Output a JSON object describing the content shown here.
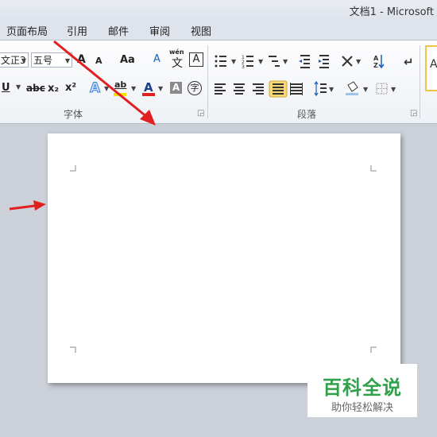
{
  "titlebar": {
    "title": "文档1 - Microsoft"
  },
  "tabs": [
    "页面布局",
    "引用",
    "邮件",
    "审阅",
    "视图"
  ],
  "font_group": {
    "label": "字体",
    "font_name": "文正3",
    "font_size": "五号",
    "grow": "A",
    "shrink": "A",
    "change_case": "Aa",
    "clear_format": "A",
    "pinyin": "wén",
    "pinyin_char": "文",
    "border": "A",
    "underline": "U",
    "strike": "abc",
    "subscript": "x₂",
    "superscript": "x²",
    "text_effect": "A",
    "highlight": "ab",
    "font_color": "A",
    "shading": "A",
    "enclose": "字"
  },
  "paragraph_group": {
    "label": "段落"
  },
  "watermark": {
    "title": "百科全说",
    "subtitle": "助你轻松解决"
  },
  "colors": {
    "accent_red": "#e02020",
    "watermark_green": "#2fa14a",
    "highlight": "#f9d976"
  }
}
